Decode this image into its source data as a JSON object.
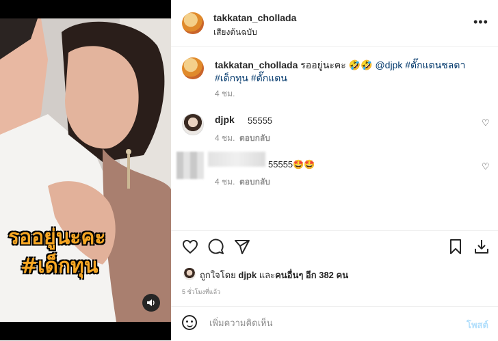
{
  "header": {
    "username": "takkatan_chollada",
    "audio_label": "เสียงต้นฉบับ"
  },
  "media": {
    "overlay_line1": "รออยู่นะคะ",
    "overlay_line2": "#เด็กทุน"
  },
  "caption": {
    "username": "takkatan_chollada",
    "text": "รออยู่นะคะ 🤣🤣",
    "mention": "@djpk",
    "tag1": "#ตั๊กแดนชลดา",
    "tag2": "#เด็กทุน",
    "tag3": "#ตั๊กแดน",
    "time": "4 ชม."
  },
  "comments": [
    {
      "username": "djpk",
      "text": "55555",
      "time": "4 ชม.",
      "reply": "ตอบกลับ"
    },
    {
      "username": "",
      "text": "55555🤩🤩",
      "time": "4 ชม.",
      "reply": "ตอบกลับ"
    }
  ],
  "likes": {
    "prefix": "ถูกใจโดย",
    "user": "djpk",
    "middle": "และ",
    "others": "คนอื่นๆ อีก 382 คน"
  },
  "ago": "5 ชั่วโมงที่แล้ว",
  "comment_box": {
    "placeholder": "เพิ่มความคิดเห็น",
    "post_label": "โพสต์"
  },
  "icons": {
    "more": "more-horizontal-icon",
    "like": "heart-outline-icon",
    "comment": "comment-bubble-icon",
    "share": "paper-plane-icon",
    "save": "bookmark-icon",
    "download": "download-icon",
    "sound": "speaker-icon",
    "emoji": "emoji-smile-icon"
  },
  "colors": {
    "link": "#00376b",
    "muted": "#8e8e8e",
    "post_disabled": "#b2dffc",
    "overlay_text": "#f6a623"
  }
}
